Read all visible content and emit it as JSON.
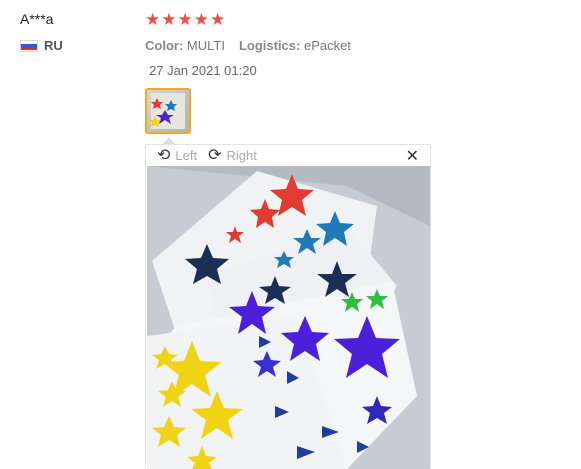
{
  "review": {
    "username": "A***a",
    "country": "RU",
    "rating": 5,
    "color_label": "Color:",
    "color_value": "MULTI",
    "logistics_label": "Logistics:",
    "logistics_value": "ePacket",
    "date": "27 Jan 2021 01:20"
  },
  "viewer": {
    "left_label": "Left",
    "right_label": "Right",
    "close_symbol": "✕",
    "icons": [
      "rotate-left-icon",
      "rotate-right-icon",
      "close-icon"
    ]
  },
  "colors": {
    "star_rating": "#f24b4b",
    "thumb_border": "#f5a623",
    "sticker_red": "#e23b32",
    "sticker_blue": "#1e7bb8",
    "sticker_purple": "#4b20d8",
    "sticker_yellow": "#f1d316",
    "sticker_green": "#2fbf45",
    "sticker_navy": "#1a2e56"
  }
}
